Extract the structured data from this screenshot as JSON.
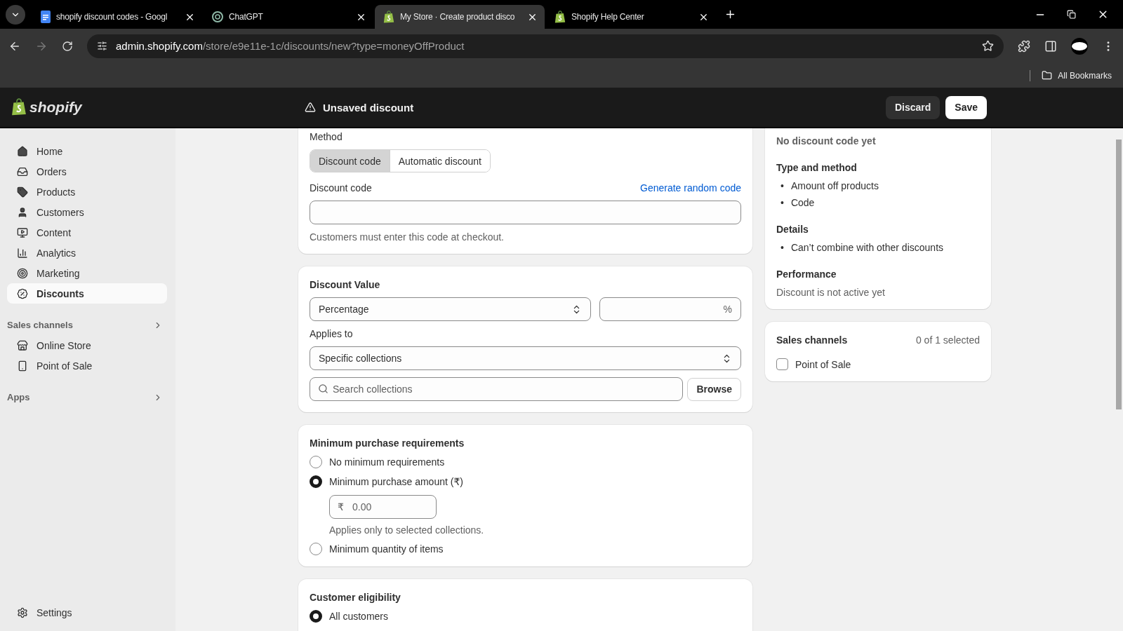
{
  "browser": {
    "tabs": [
      {
        "title": "shopify discount codes - Googl",
        "selected": false
      },
      {
        "title": "ChatGPT",
        "selected": false
      },
      {
        "title": "My Store · Create product disco",
        "selected": true
      },
      {
        "title": "Shopify Help Center",
        "selected": false
      }
    ],
    "url": {
      "host": "admin.shopify.com",
      "path": "/store/e9e11e-1c/discounts/new?type=moneyOffProduct"
    },
    "bookmarks": "All Bookmarks"
  },
  "topbar": {
    "logo": "shopify",
    "title": "Unsaved discount",
    "buttons": [
      {
        "label": "Discard",
        "kind": "secondary"
      },
      {
        "label": "Save",
        "kind": "primary"
      }
    ]
  },
  "sidebar": {
    "items": [
      {
        "label": "Home",
        "selected": false
      },
      {
        "label": "Orders",
        "selected": false
      },
      {
        "label": "Products",
        "selected": false
      },
      {
        "label": "Customers",
        "selected": false
      },
      {
        "label": "Content",
        "selected": false
      },
      {
        "label": "Analytics",
        "selected": false
      },
      {
        "label": "Marketing",
        "selected": false
      },
      {
        "label": "Discounts",
        "selected": true
      }
    ],
    "sections": [
      {
        "title": "Sales channels",
        "items": [
          {
            "label": "Online Store",
            "selected": false
          },
          {
            "label": "Point of Sale",
            "selected": false
          }
        ]
      },
      {
        "title": "Apps"
      }
    ],
    "settings": "Settings"
  },
  "method": {
    "label": "Method",
    "options": [
      {
        "label": "Discount code",
        "selected": true
      },
      {
        "label": "Automatic discount",
        "selected": false
      }
    ],
    "code_label": "Discount code",
    "generate_link": "Generate random code",
    "hint": "Customers must enter this code at checkout."
  },
  "discount_value": {
    "title": "Discount Value",
    "type_select": "Percentage",
    "value_suffix": "%",
    "applies_label": "Applies to",
    "applies_select": "Specific collections",
    "search_placeholder": "Search collections",
    "browse": "Browse"
  },
  "minimum": {
    "title": "Minimum purchase requirements",
    "options": [
      {
        "label": "No minimum requirements",
        "selected": false
      },
      {
        "label": "Minimum purchase amount (₹)",
        "selected": true,
        "amount": {
          "prefix": "₹",
          "placeholder": "0.00"
        },
        "hint": "Applies only to selected collections."
      },
      {
        "label": "Minimum quantity of items",
        "selected": false
      }
    ]
  },
  "eligibility": {
    "title": "Customer eligibility",
    "options": [
      {
        "label": "All customers",
        "selected": true
      }
    ]
  },
  "summary": {
    "code": "No discount code yet",
    "marker": "•",
    "sections": [
      {
        "title": "Type and method",
        "bullets": [
          "Amount off products",
          "Code"
        ]
      },
      {
        "title": "Details",
        "bullets": [
          "Can’t combine with other discounts"
        ]
      },
      {
        "title": "Performance",
        "text": "Discount is not active yet"
      }
    ]
  },
  "sales_channels": {
    "title": "Sales channels",
    "count": "0 of 1 selected",
    "channels": [
      {
        "label": "Point of Sale",
        "checked": false
      }
    ]
  }
}
